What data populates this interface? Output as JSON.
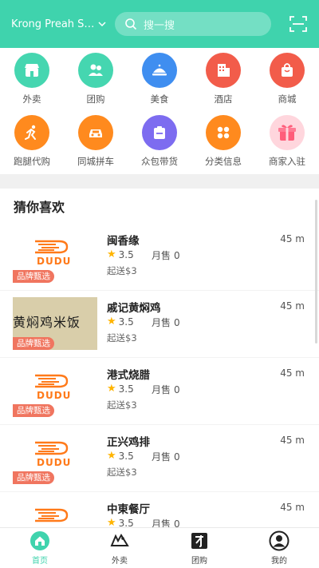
{
  "header": {
    "location": "Krong Preah Si...",
    "search_placeholder": "搜一搜",
    "scan_icon": "scan-icon",
    "colors": {
      "accent": "#3fd3ad"
    }
  },
  "categories": [
    {
      "label": "外卖",
      "icon": "store-icon",
      "color": "#45d6b0"
    },
    {
      "label": "团购",
      "icon": "group-icon",
      "color": "#45d6b0"
    },
    {
      "label": "美食",
      "icon": "dish-icon",
      "color": "#3f8ef0"
    },
    {
      "label": "酒店",
      "icon": "hotel-icon",
      "color": "#f25c4a"
    },
    {
      "label": "商城",
      "icon": "shop-icon",
      "color": "#f25c4a"
    },
    {
      "label": "跑腿代购",
      "icon": "runner-icon",
      "color": "#ff8a1e"
    },
    {
      "label": "同城拼车",
      "icon": "car-icon",
      "color": "#ff8a1e"
    },
    {
      "label": "众包带货",
      "icon": "package-icon",
      "color": "#7d6cf0"
    },
    {
      "label": "分类信息",
      "icon": "grid-icon",
      "color": "#ff8a1e"
    },
    {
      "label": "商家入驻",
      "icon": "gift-icon",
      "color": "#ff5d7a"
    }
  ],
  "section": {
    "title": "猜你喜欢"
  },
  "shops": [
    {
      "name": "闽香缘",
      "distance": "45 m",
      "rating": "3.5",
      "sales_label": "月售",
      "sales": "0",
      "delivery": "起送$3",
      "badge": "品牌甄选",
      "thumb": "dudu"
    },
    {
      "name": "戚记黄焖鸡",
      "distance": "45 m",
      "rating": "3.5",
      "sales_label": "月售",
      "sales": "0",
      "delivery": "起送$3",
      "badge": "品牌甄选",
      "thumb": "photo",
      "photo_text": "黄焖鸡米饭"
    },
    {
      "name": "港式烧腊",
      "distance": "45 m",
      "rating": "3.5",
      "sales_label": "月售",
      "sales": "0",
      "delivery": "起送$3",
      "badge": "品牌甄选",
      "thumb": "dudu"
    },
    {
      "name": "正兴鸡排",
      "distance": "45 m",
      "rating": "3.5",
      "sales_label": "月售",
      "sales": "0",
      "delivery": "起送$3",
      "badge": "品牌甄选",
      "thumb": "dudu"
    },
    {
      "name": "中東餐厅",
      "distance": "45 m",
      "rating": "3.5",
      "sales_label": "月售",
      "sales": "0",
      "delivery": "",
      "badge": "",
      "thumb": "dudu"
    }
  ],
  "dudu_logo_text": "DUDU",
  "tabs": [
    {
      "label": "首页",
      "icon": "home-icon",
      "active": true
    },
    {
      "label": "外卖",
      "icon": "takeout-icon",
      "active": false
    },
    {
      "label": "团购",
      "icon": "tuan-icon",
      "active": false
    },
    {
      "label": "我的",
      "icon": "profile-icon",
      "active": false
    }
  ],
  "tab_glyphs": {
    "takeout": "外",
    "tuan": "团"
  }
}
